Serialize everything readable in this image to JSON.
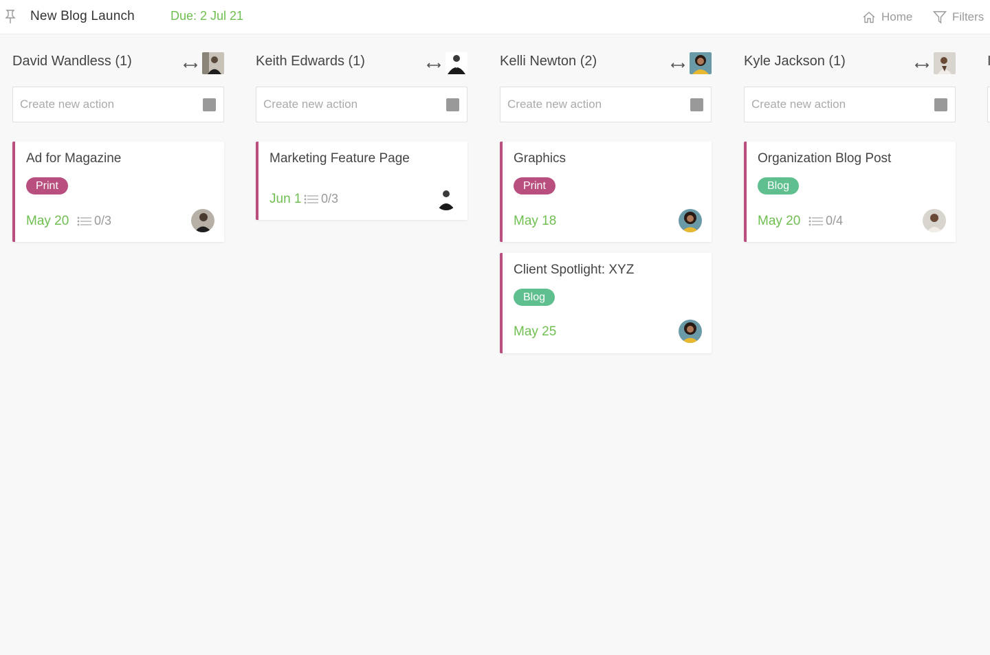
{
  "header": {
    "project_title": "New Blog Launch",
    "due": "Due: 2 Jul 21",
    "home_label": "Home",
    "filters_label": "Filters"
  },
  "create_placeholder": "Create new action",
  "columns": [
    {
      "name": "David Wandless (1)",
      "cards": [
        {
          "title": "Ad for Magazine",
          "tag": "Print",
          "date": "May 20",
          "checklist": "0/3"
        }
      ]
    },
    {
      "name": "Keith Edwards (1)",
      "cards": [
        {
          "title": "Marketing Feature Page",
          "date": "Jun 1",
          "checklist": "0/3"
        }
      ]
    },
    {
      "name": "Kelli Newton (2)",
      "cards": [
        {
          "title": "Graphics",
          "tag": "Print",
          "date": "May 18"
        },
        {
          "title": "Client Spotlight: XYZ",
          "tag": "Blog",
          "date": "May 25"
        }
      ]
    },
    {
      "name": "Kyle Jackson (1)",
      "cards": [
        {
          "title": "Organization Blog Post",
          "tag": "Blog",
          "date": "May 20",
          "checklist": "0/4"
        }
      ]
    }
  ],
  "next_column_initial": "I",
  "colors": {
    "accent_green": "#6fbf50",
    "print_tag": "#b84f7e",
    "blog_tag": "#5fbf8f",
    "card_border": "#b84f7e"
  }
}
